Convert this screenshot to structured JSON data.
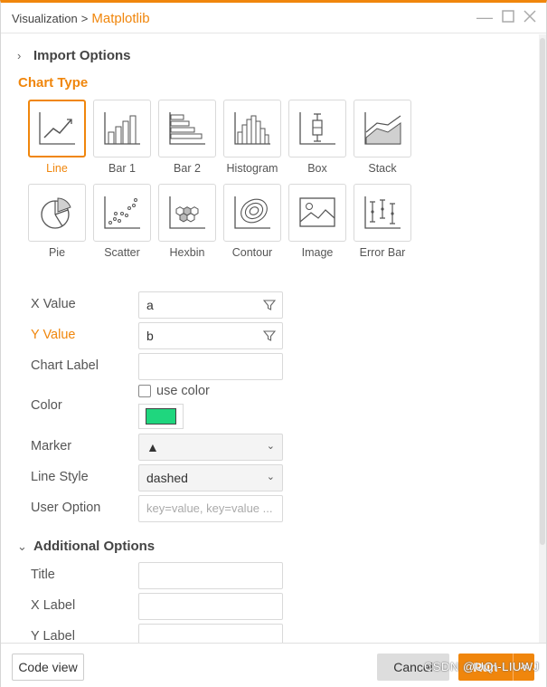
{
  "breadcrumb": {
    "parent": "Visualization",
    "separator": ">",
    "current": "Matplotlib"
  },
  "sections": {
    "import_options": "Import Options",
    "chart_type": "Chart Type",
    "additional_options": "Additional Options"
  },
  "chart_types": [
    {
      "label": "Line",
      "icon": "line-chart-icon",
      "selected": true
    },
    {
      "label": "Bar 1",
      "icon": "bar-chart-icon"
    },
    {
      "label": "Bar 2",
      "icon": "horizontal-bar-chart-icon"
    },
    {
      "label": "Histogram",
      "icon": "histogram-icon"
    },
    {
      "label": "Box",
      "icon": "box-plot-icon"
    },
    {
      "label": "Stack",
      "icon": "stacked-area-icon"
    },
    {
      "label": "Pie",
      "icon": "pie-chart-icon"
    },
    {
      "label": "Scatter",
      "icon": "scatter-plot-icon"
    },
    {
      "label": "Hexbin",
      "icon": "hexbin-icon"
    },
    {
      "label": "Contour",
      "icon": "contour-icon"
    },
    {
      "label": "Image",
      "icon": "image-icon"
    },
    {
      "label": "Error Bar",
      "icon": "error-bar-icon"
    }
  ],
  "form": {
    "x_value": {
      "label": "X Value",
      "value": "a"
    },
    "y_value": {
      "label": "Y Value",
      "value": "b"
    },
    "chart_label": {
      "label": "Chart Label",
      "value": ""
    },
    "color": {
      "label": "Color",
      "checkbox_label": "use color",
      "swatch": "#1fd67e"
    },
    "marker": {
      "label": "Marker",
      "value": "▲"
    },
    "line_style": {
      "label": "Line Style",
      "value": "dashed"
    },
    "user_option": {
      "label": "User Option",
      "placeholder": "key=value, key=value ..."
    }
  },
  "additional": {
    "title": {
      "label": "Title"
    },
    "x_label": {
      "label": "X Label"
    },
    "y_label": {
      "label": "Y Label"
    }
  },
  "footer": {
    "code_view": "Code view",
    "cancel": "Cancel",
    "run": "Run"
  },
  "watermark": "CSDN @UQI-LIUWJ",
  "colors": {
    "accent": "#f0860c"
  }
}
